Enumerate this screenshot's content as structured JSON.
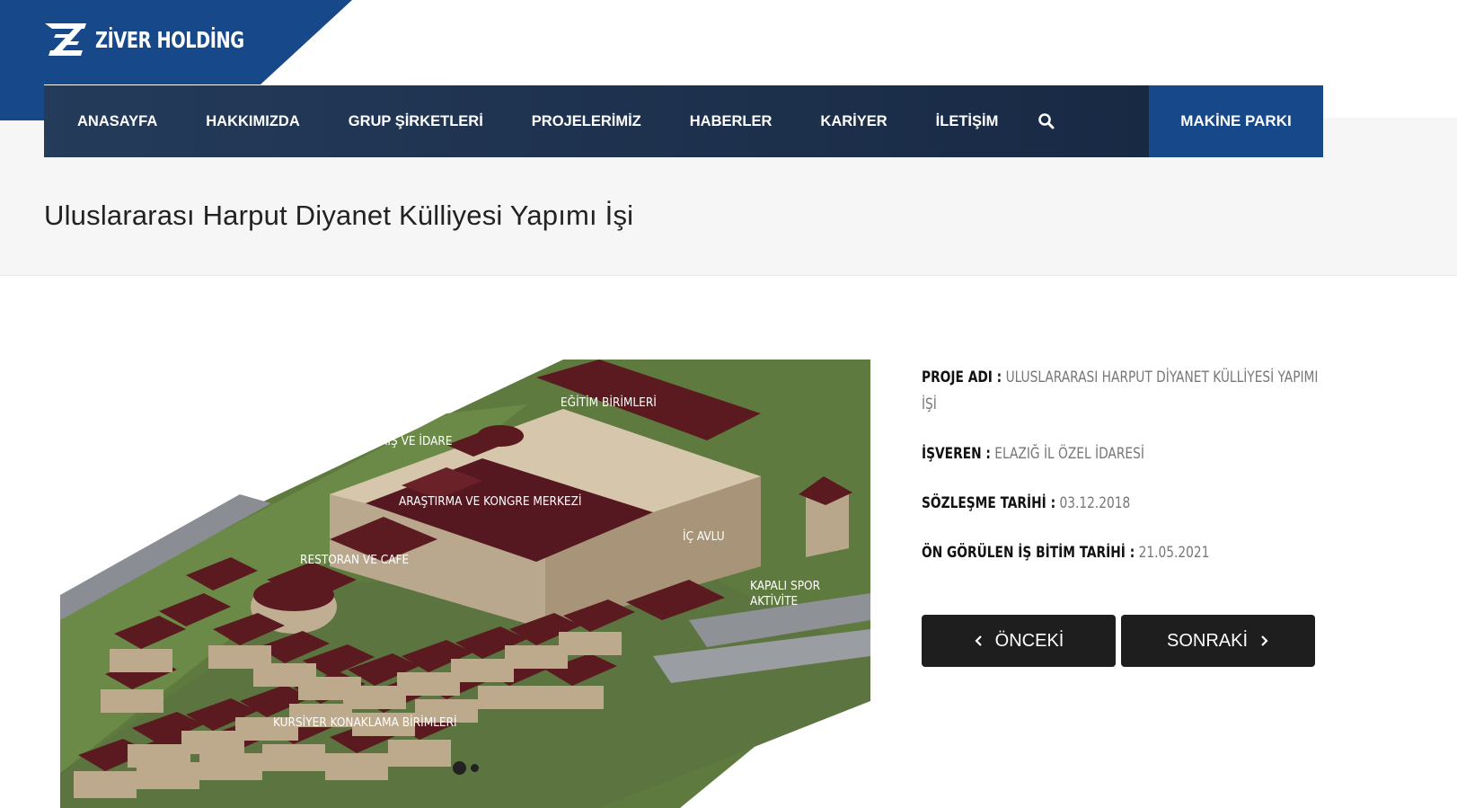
{
  "brand": {
    "name": "ZİVER HOLDİNG",
    "primary_color": "#16488a",
    "nav_color": "#1f3450"
  },
  "nav": {
    "items": [
      "ANASAYFA",
      "HAKKIMIZDA",
      "GRUP ŞİRKETLERİ",
      "PROJELERİMİZ",
      "HABERLER",
      "KARİYER",
      "İLETİŞİM"
    ],
    "search_icon": "search-icon",
    "cta": "MAKİNE PARKI"
  },
  "page": {
    "title": "Uluslararası Harput Diyanet Külliyesi Yapımı İşi"
  },
  "slider": {
    "labels": {
      "egitim": "EĞİTİM BİRİMLERİ",
      "giris": "GİRİŞ VE İDARE",
      "arastirma": "ARAŞTIRMA VE KONGRE MERKEZİ",
      "icavlu": "İÇ AVLU",
      "restoran": "RESTORAN VE CAFE",
      "spor1": "KAPALI SPOR",
      "spor2": "AKTİVİTE",
      "konaklama": "KURSİYER KONAKLAMA BİRİMLERİ"
    },
    "slide_count": 2,
    "active_slide": 1
  },
  "details": {
    "project_name_label": "PROJE ADI :",
    "project_name_value": "ULUSLARARASI HARPUT DİYANET KÜLLİYESİ YAPIMI İŞİ",
    "employer_label": "İŞVEREN :",
    "employer_value": "ELAZIĞ İL ÖZEL İDARESİ",
    "contract_date_label": "SÖZLEŞME TARİHİ :",
    "contract_date_value": "03.12.2018",
    "end_date_label": "ÖN GÖRÜLEN İŞ BİTİM TARİHİ :",
    "end_date_value": "21.05.2021"
  },
  "buttons": {
    "prev": "ÖNCEKİ",
    "next": "SONRAKİ"
  }
}
